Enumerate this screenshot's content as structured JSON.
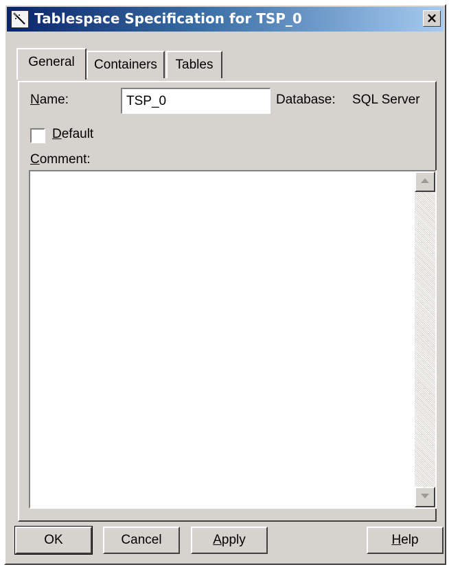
{
  "window": {
    "title": "Tablespace Specification for TSP_0",
    "close_label": "×"
  },
  "tabs": [
    {
      "label": "General",
      "active": true
    },
    {
      "label": "Containers",
      "active": false
    },
    {
      "label": "Tables",
      "active": false
    }
  ],
  "general": {
    "name_label_first": "N",
    "name_label_rest": "ame:",
    "name_value": "TSP_0",
    "database_label": "Database:",
    "database_value": "SQL Server",
    "default_label_first": "D",
    "default_label_rest": "efault",
    "default_checked": false,
    "comment_label_first": "C",
    "comment_label_rest": "omment:",
    "comment_value": ""
  },
  "buttons": {
    "ok": "OK",
    "cancel": "Cancel",
    "apply_first": "A",
    "apply_rest": "pply",
    "help_first": "H",
    "help_rest": "elp"
  },
  "icons": {
    "app": "tool-wand-icon",
    "close": "close-icon",
    "scroll_up": "arrow-up-icon",
    "scroll_down": "arrow-down-icon"
  },
  "colors": {
    "dialog": "#d6d3ce",
    "title_start": "#0a246a",
    "title_end": "#a6caf0"
  }
}
